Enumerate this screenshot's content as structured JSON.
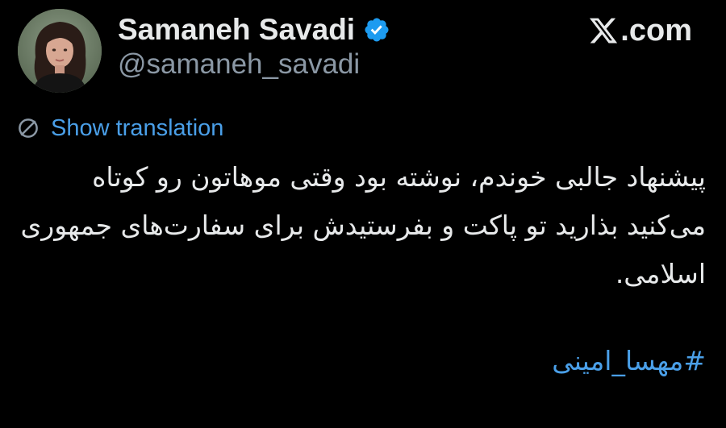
{
  "author": {
    "display_name": "Samaneh Savadi",
    "handle": "@samaneh_savadi",
    "verified": true,
    "badge_color": "#1d9bf0"
  },
  "site": {
    "logo_icon": "x-logo-icon",
    "domain_suffix": ".com"
  },
  "translation": {
    "icon": "globe-icon",
    "label": "Show translation"
  },
  "tweet": {
    "text": "پیشنهاد جالبی خوندم، نوشته بود وقتی موهاتون رو کوتاه می‌کنید بذارید تو پاکت و بفرستیدش برای سفارت‌های جمهوری اسلامی.",
    "hashtag": "#مهسا_امینی"
  },
  "colors": {
    "background": "#000000",
    "text": "#e7e9ea",
    "secondary_text": "#8b98a5",
    "link": "#4a9fe8"
  }
}
